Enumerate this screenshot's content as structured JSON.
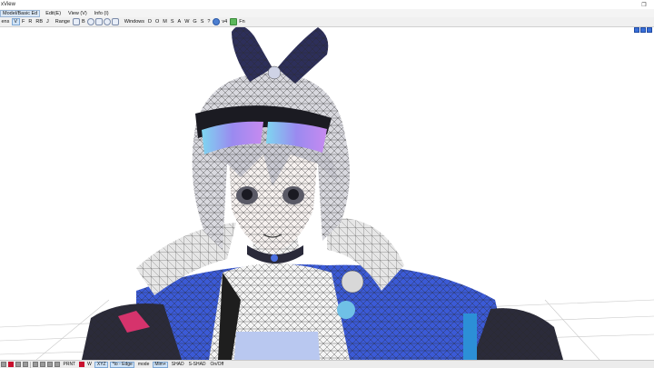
{
  "window": {
    "title": "xView",
    "restore_glyph": "❐"
  },
  "menubar": [
    {
      "id": "model",
      "label": "Model/Basic Ed",
      "active": true
    },
    {
      "id": "edit",
      "label": "Edit(E)"
    },
    {
      "id": "view",
      "label": "View (V)"
    },
    {
      "id": "info",
      "label": "Info (I)"
    }
  ],
  "toolbar": {
    "left": [
      "ens",
      "V",
      "F",
      "R",
      "RB",
      "J"
    ],
    "range_label": "Range",
    "mode_buttons": [
      "B"
    ],
    "windows_label": "Windows",
    "window_buttons": [
      "D",
      "O",
      "M",
      "S",
      "A",
      "W",
      "G",
      "S",
      "?"
    ],
    "v4_label": "v4",
    "fn_label": "Fn"
  },
  "statusbar": {
    "items": [
      "PRNT",
      "W",
      "XYZ",
      "*to - Edge",
      "mode",
      "Mim+",
      "SHAD",
      "S-SHAD",
      "On/Off"
    ]
  },
  "colors": {
    "accent": "#3a6fd8",
    "mesh_line": "#2a2a2a",
    "jacket": "#3b5ad6",
    "visor": "#8f6de8"
  }
}
